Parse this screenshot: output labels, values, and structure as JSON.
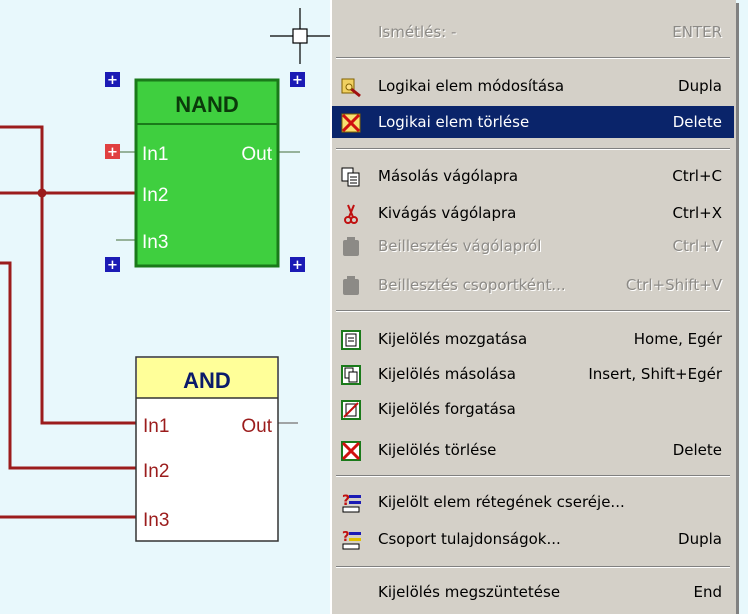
{
  "diagram": {
    "nand": {
      "title": "NAND",
      "in1": "In1",
      "in2": "In2",
      "in3": "In3",
      "out": "Out"
    },
    "and": {
      "title": "AND",
      "in1": "In1",
      "in2": "In2",
      "in3": "In3",
      "out": "Out"
    }
  },
  "menu": {
    "items": [
      {
        "label": "Ismétlés: -",
        "shortcut": "ENTER",
        "state": "disabled",
        "icon": "none"
      },
      {
        "label": "Logikai elem módosítása",
        "shortcut": "Dupla",
        "state": "normal",
        "icon": "edit-element-icon"
      },
      {
        "label": "Logikai elem törlése",
        "shortcut": "Delete",
        "state": "highlighted",
        "icon": "delete-element-icon"
      },
      {
        "label": "Másolás vágólapra",
        "shortcut": "Ctrl+C",
        "state": "normal",
        "icon": "copy-icon"
      },
      {
        "label": "Kivágás vágólapra",
        "shortcut": "Ctrl+X",
        "state": "normal",
        "icon": "cut-icon"
      },
      {
        "label": "Beillesztés vágólapról",
        "shortcut": "Ctrl+V",
        "state": "disabled",
        "icon": "paste-icon"
      },
      {
        "label": "Beillesztés csoportként...",
        "shortcut": "Ctrl+Shift+V",
        "state": "disabled",
        "icon": "paste-group-icon"
      },
      {
        "label": "Kijelölés mozgatása",
        "shortcut": "Home, Egér",
        "state": "normal",
        "icon": "move-selection-icon"
      },
      {
        "label": "Kijelölés másolása",
        "shortcut": "Insert, Shift+Egér",
        "state": "normal",
        "icon": "copy-selection-icon"
      },
      {
        "label": "Kijelölés forgatása",
        "shortcut": "",
        "state": "normal",
        "icon": "rotate-selection-icon"
      },
      {
        "label": "Kijelölés törlése",
        "shortcut": "Delete",
        "state": "normal",
        "icon": "delete-selection-icon"
      },
      {
        "label": "Kijelölt elem rétegének cseréje...",
        "shortcut": "",
        "state": "normal",
        "icon": "change-layer-icon"
      },
      {
        "label": "Csoport tulajdonságok...",
        "shortcut": "Dupla",
        "state": "normal",
        "icon": "group-properties-icon"
      },
      {
        "label": "Kijelölés megszüntetése",
        "shortcut": "End",
        "state": "normal",
        "icon": "none"
      }
    ]
  },
  "colors": {
    "canvas_bg": "#e8f8fc",
    "wire": "#9b1c1c",
    "nand_fill": "#3fcf3f",
    "and_header": "#ffff99",
    "handle_blue": "#1b1bb5",
    "handle_red": "#e04040",
    "menu_bg": "#d4d0c8",
    "highlight": "#0a246a"
  }
}
